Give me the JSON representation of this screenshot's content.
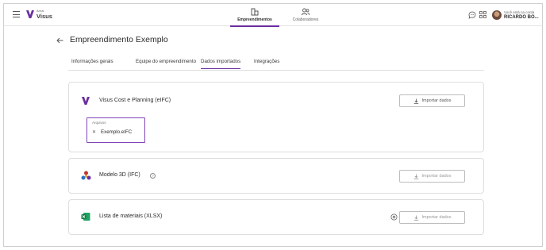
{
  "brand": {
    "small": "Arnal",
    "name": "Visus"
  },
  "nav": {
    "tabs": [
      {
        "label": "Empreendimentos",
        "active": true,
        "icon": "building-icon"
      },
      {
        "label": "Colaboradores",
        "active": false,
        "icon": "people-icon"
      }
    ]
  },
  "account": {
    "hint": "Você está na conta",
    "name": "RICARDO BO..."
  },
  "page": {
    "title": "Empreendimento Exemplo",
    "tabs": [
      {
        "label": "Informações gerais"
      },
      {
        "label": "Equipe do empreendimento"
      },
      {
        "label": "Dados importados",
        "active": true
      },
      {
        "label": "Integrações"
      }
    ]
  },
  "cards": [
    {
      "title": "Visus Cost e Planning (eIFC)",
      "icon": "visus-logo-icon",
      "button": "Importar dados",
      "files": {
        "label": "Arquivos",
        "items": [
          "Exemplo.eIFC"
        ]
      }
    },
    {
      "title": "Modelo 3D (IFC)",
      "icon": "ifc-model-icon",
      "button": "Importar dados",
      "help": "?"
    },
    {
      "title": "Lista de materiais (XLSX)",
      "icon": "excel-icon",
      "button": "Importar dados"
    }
  ],
  "colors": {
    "accent": "#6a2ea0",
    "files_border": "#7e44b5"
  }
}
